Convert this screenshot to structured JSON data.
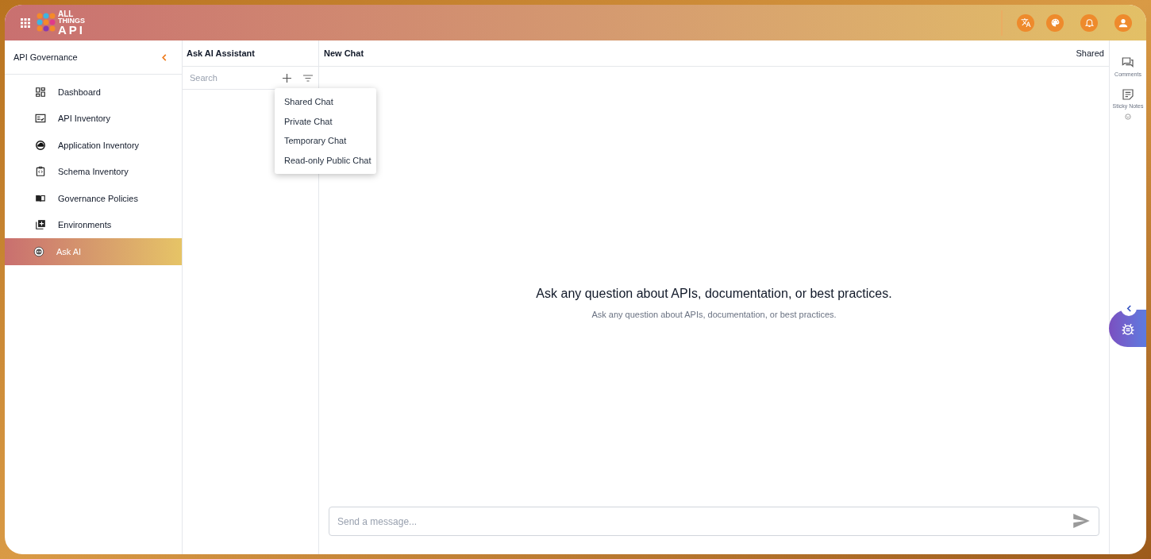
{
  "header": {
    "logo": {
      "line1": "ALL",
      "line2": "THINGS",
      "line3": "API"
    }
  },
  "sidebar": {
    "title": "API Governance",
    "items": [
      {
        "label": "Dashboard",
        "selected": false
      },
      {
        "label": "API Inventory",
        "selected": false
      },
      {
        "label": "Application Inventory",
        "selected": false
      },
      {
        "label": "Schema Inventory",
        "selected": false
      },
      {
        "label": "Governance Policies",
        "selected": false
      },
      {
        "label": "Environments",
        "selected": false
      },
      {
        "label": "Ask AI",
        "selected": true
      }
    ]
  },
  "chat_list": {
    "title": "Ask AI Assistant",
    "search": {
      "placeholder": "Search"
    },
    "menu": [
      "Shared Chat",
      "Private Chat",
      "Temporary Chat",
      "Read-only Public Chat"
    ]
  },
  "chat": {
    "title": "New Chat",
    "visibility": "Shared",
    "empty_title": "Ask any question about APIs, documentation, or best practices.",
    "empty_subtitle": "Ask any question about APIs, documentation, or best practices.",
    "input": {
      "placeholder": "Send a message..."
    }
  },
  "right_rail": [
    {
      "label": "Comments"
    },
    {
      "label": "Sticky Notes"
    }
  ]
}
